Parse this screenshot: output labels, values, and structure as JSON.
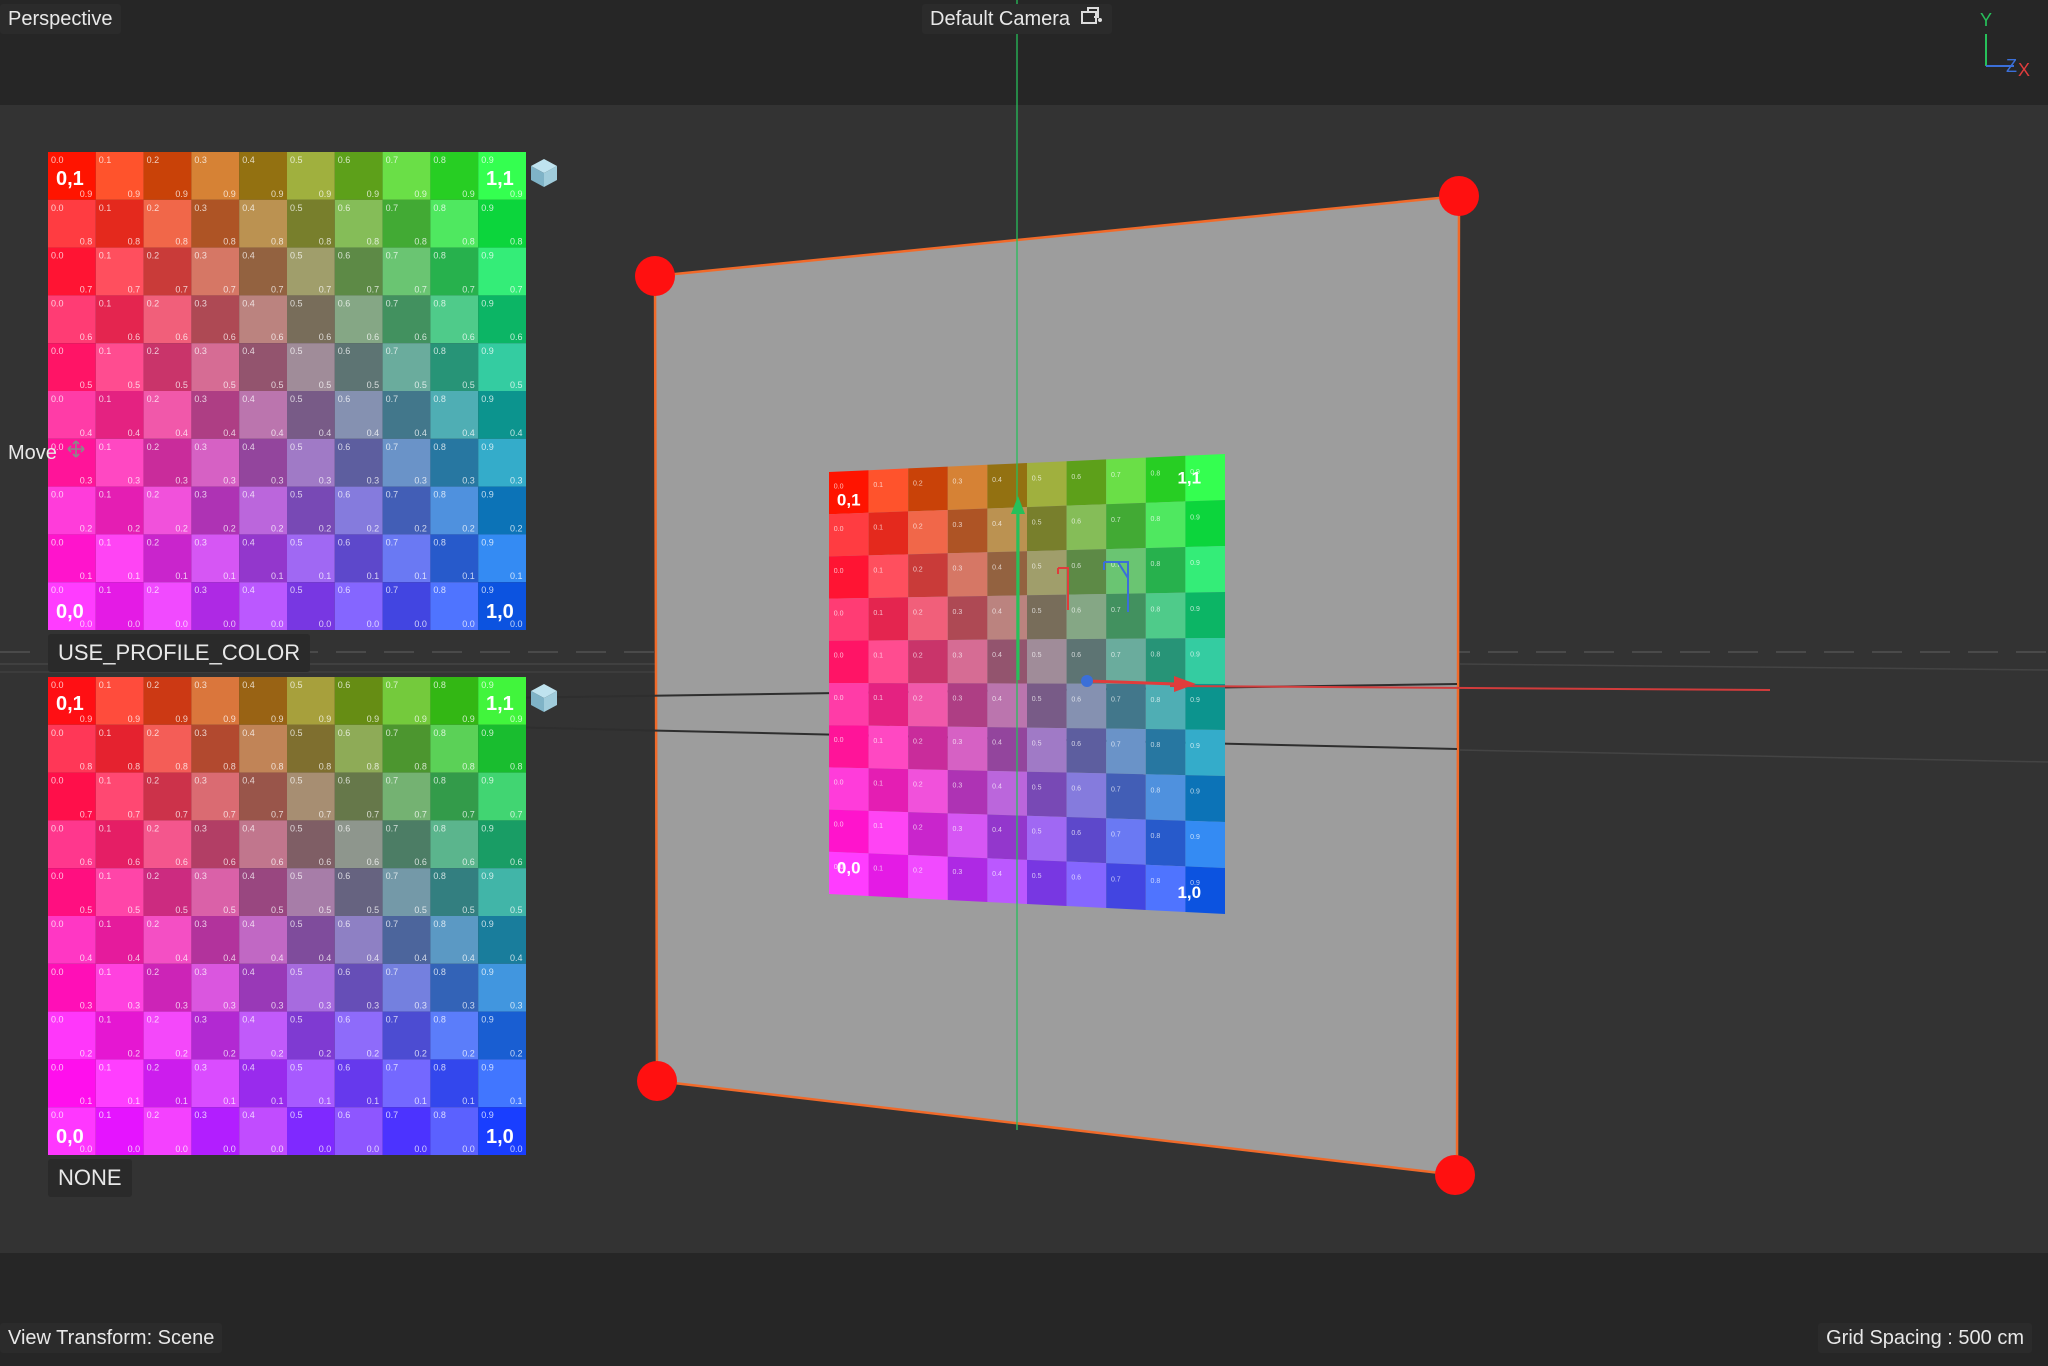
{
  "viewport": {
    "view_name": "Perspective",
    "camera_name": "Default Camera",
    "camera_icon": "camera-settings-icon",
    "tool_label": "Move",
    "tool_icon": "move-icon",
    "view_transform": "View Transform: Scene",
    "grid_spacing": "Grid Spacing : 500 cm"
  },
  "axis_gizmo": {
    "y": "Y",
    "z": "Z",
    "x": "X"
  },
  "textures": [
    {
      "label": "USE_PROFILE_COLOR",
      "corner_top_left": "0,1",
      "corner_top_right": "1,1",
      "corner_bottom_left": "0,0",
      "corner_bottom_right": "1,0",
      "icon": "cube-icon"
    },
    {
      "label": "NONE",
      "corner_top_left": "0,1",
      "corner_top_right": "1,1",
      "corner_bottom_left": "0,0",
      "corner_bottom_right": "1,0",
      "icon": "cube-icon"
    }
  ],
  "scene_texture": {
    "corner_top_left": "0,1",
    "corner_top_right": "1,1",
    "corner_bottom_left": "0,0",
    "corner_bottom_right": "1,0"
  },
  "grid_cell_values": [
    "0.0",
    "0.1",
    "0.2",
    "0.3",
    "0.4",
    "0.5",
    "0.6",
    "0.7",
    "0.8",
    "0.9"
  ],
  "colors": {
    "handle": "#ff1010",
    "plane_outline": "#f06a2a",
    "plane_fill": "#9d9d9d",
    "y_axis": "#27c05a",
    "x_axis": "#e03c3c",
    "z_axis": "#3b6fd8"
  }
}
